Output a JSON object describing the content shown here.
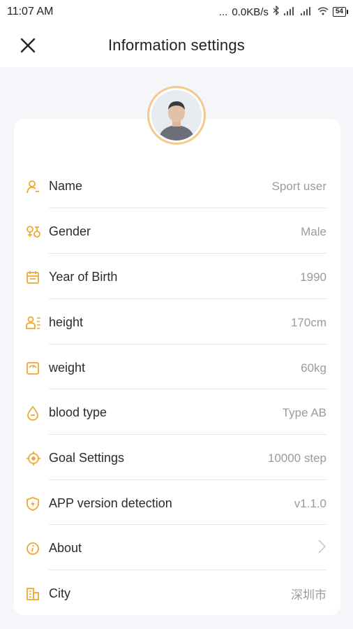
{
  "status_bar": {
    "time": "11:07",
    "ampm": "AM",
    "dots": "...",
    "network_speed": "0.0KB/s",
    "battery": "54"
  },
  "header": {
    "title": "Information settings",
    "close_icon": "close-icon"
  },
  "profile": {
    "avatar_icon": "user-avatar"
  },
  "rows": [
    {
      "label": "Name",
      "value": "Sport user",
      "icon": "person-icon"
    },
    {
      "label": "Gender",
      "value": "Male",
      "icon": "gender-icon"
    },
    {
      "label": "Year of Birth",
      "value": "1990",
      "icon": "calendar-icon"
    },
    {
      "label": "height",
      "value": "170cm",
      "icon": "height-icon"
    },
    {
      "label": "weight",
      "value": "60kg",
      "icon": "scale-icon"
    },
    {
      "label": "blood type",
      "value": "Type AB",
      "icon": "blood-drop-icon"
    },
    {
      "label": "Goal Settings",
      "value": "10000 step",
      "icon": "target-icon"
    },
    {
      "label": "APP version detection",
      "value": "v1.1.0",
      "icon": "shield-icon"
    },
    {
      "label": "About",
      "value": "",
      "icon": "info-icon"
    },
    {
      "label": "City",
      "value": "深圳市",
      "icon": "building-icon"
    }
  ],
  "colors": {
    "accent": "#f0a830",
    "value_text": "#9b9b9b",
    "background": "#f4f6f9"
  }
}
